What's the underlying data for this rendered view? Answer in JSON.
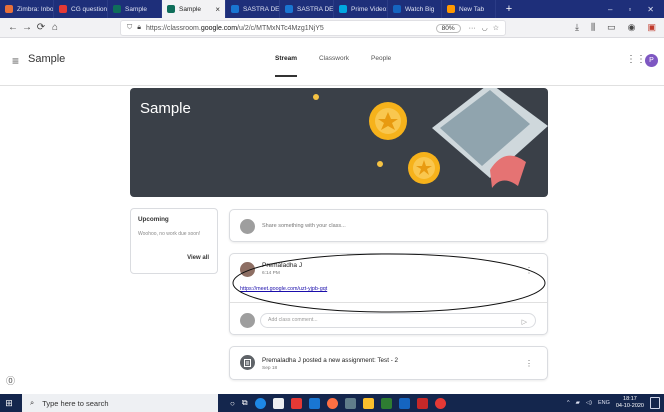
{
  "browser": {
    "tabs": [
      {
        "label": "Zimbra: Inbox",
        "color": "#e8703a",
        "active": false
      },
      {
        "label": "CG questions",
        "color": "#e53935",
        "active": false
      },
      {
        "label": "Sample",
        "color": "#0f6e5a",
        "active": false
      },
      {
        "label": "Sample",
        "color": "#0f6e5a",
        "active": true
      },
      {
        "label": "SASTRA DEEM",
        "color": "#1976d2",
        "active": false
      },
      {
        "label": "SASTRA DEEM",
        "color": "#1976d2",
        "active": false
      },
      {
        "label": "Prime Video:",
        "color": "#00a8e1",
        "active": false
      },
      {
        "label": "Watch Big",
        "color": "#1565c0",
        "active": false
      },
      {
        "label": "New Tab",
        "color": "#ff9800",
        "active": false
      }
    ],
    "tab_close": "×",
    "new_tab": "+",
    "window_controls": [
      "–",
      "▫",
      "✕"
    ],
    "url_prefix": "https://classroom.",
    "url_domain": "google.com",
    "url_path": "/u/2/c/MTMxNTc4Mzg1NjY5",
    "zoom": "80%",
    "menu_dots": "···"
  },
  "classroom": {
    "class_title": "Sample",
    "tabs": [
      "Stream",
      "Classwork",
      "People"
    ],
    "active_tab": "Stream",
    "avatar_letter": "P",
    "avatar_color": "#7e57c2",
    "banner_title": "Sample",
    "banner_color": "#3a4048",
    "upcoming": {
      "title": "Upcoming",
      "message": "Woohoo, no work due soon!",
      "view_all": "View all"
    },
    "share_placeholder": "Share something with your class...",
    "post": {
      "author": "Premaladha J",
      "time": "6:14 PM",
      "link": "https://meet.google.com/uzt-yjpb-gqt",
      "comment_placeholder": "Add class comment..."
    },
    "assignment": {
      "title": "Premaladha J posted a new assignment: Test - 2",
      "date": "Sep 18"
    }
  },
  "taskbar": {
    "search_placeholder": "Type here to search",
    "language": "ENG",
    "time": "18:17",
    "date": "04-10-2020"
  }
}
